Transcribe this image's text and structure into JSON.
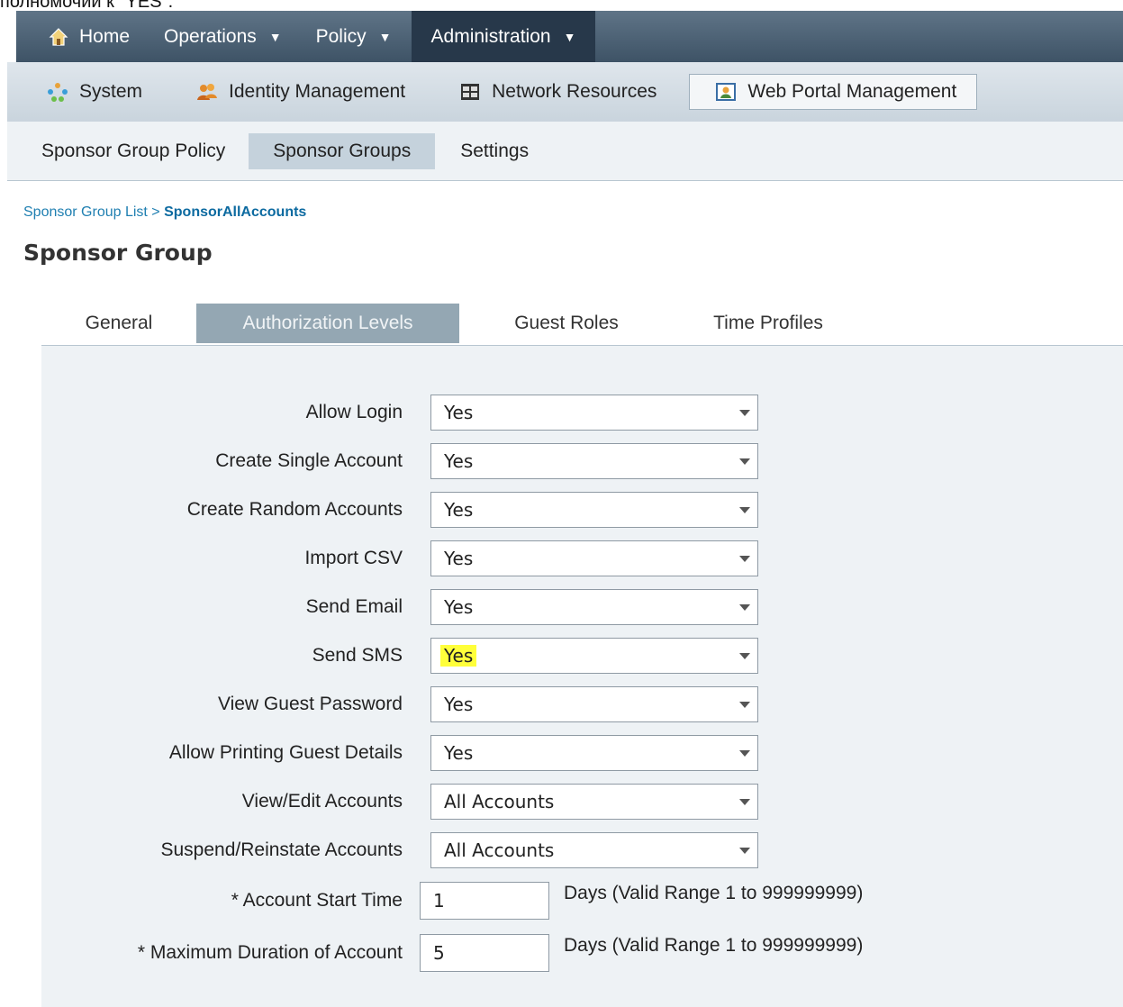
{
  "caption": "полномочий к \"YES\".",
  "topnav": {
    "home": "Home",
    "operations": "Operations",
    "policy": "Policy",
    "administration": "Administration",
    "caret": "▼"
  },
  "subnav": {
    "system": "System",
    "identity": "Identity Management",
    "network": "Network Resources",
    "webportal": "Web Portal Management"
  },
  "thirdnav": {
    "policy": "Sponsor Group Policy",
    "groups": "Sponsor Groups",
    "settings": "Settings"
  },
  "breadcrumb": {
    "list": "Sponsor Group List",
    "sep": " > ",
    "current": "SponsorAllAccounts"
  },
  "page_title": "Sponsor Group",
  "tabs": {
    "general": "General",
    "authorization": "Authorization Levels",
    "roles": "Guest Roles",
    "profiles": "Time Profiles"
  },
  "form": {
    "rows": [
      {
        "label": "Allow Login",
        "value": "Yes"
      },
      {
        "label": "Create Single Account",
        "value": "Yes"
      },
      {
        "label": "Create Random Accounts",
        "value": "Yes"
      },
      {
        "label": "Import CSV",
        "value": "Yes"
      },
      {
        "label": "Send Email",
        "value": "Yes"
      },
      {
        "label": "Send SMS",
        "value": "Yes",
        "highlighted": true
      },
      {
        "label": "View Guest Password",
        "value": "Yes"
      },
      {
        "label": "Allow Printing Guest Details",
        "value": "Yes"
      },
      {
        "label": "View/Edit Accounts",
        "value": "All Accounts"
      },
      {
        "label": "Suspend/Reinstate Accounts",
        "value": "All Accounts"
      }
    ],
    "start_time": {
      "label": "* Account Start Time",
      "value": "1",
      "hint": "Days (Valid Range 1 to 999999999)"
    },
    "max_duration": {
      "label": "* Maximum Duration of Account",
      "value": "5",
      "hint": "Days (Valid Range 1 to 999999999)"
    }
  },
  "colors": {
    "highlight": "#ffff3a",
    "active_tab": "#94a7b3"
  }
}
